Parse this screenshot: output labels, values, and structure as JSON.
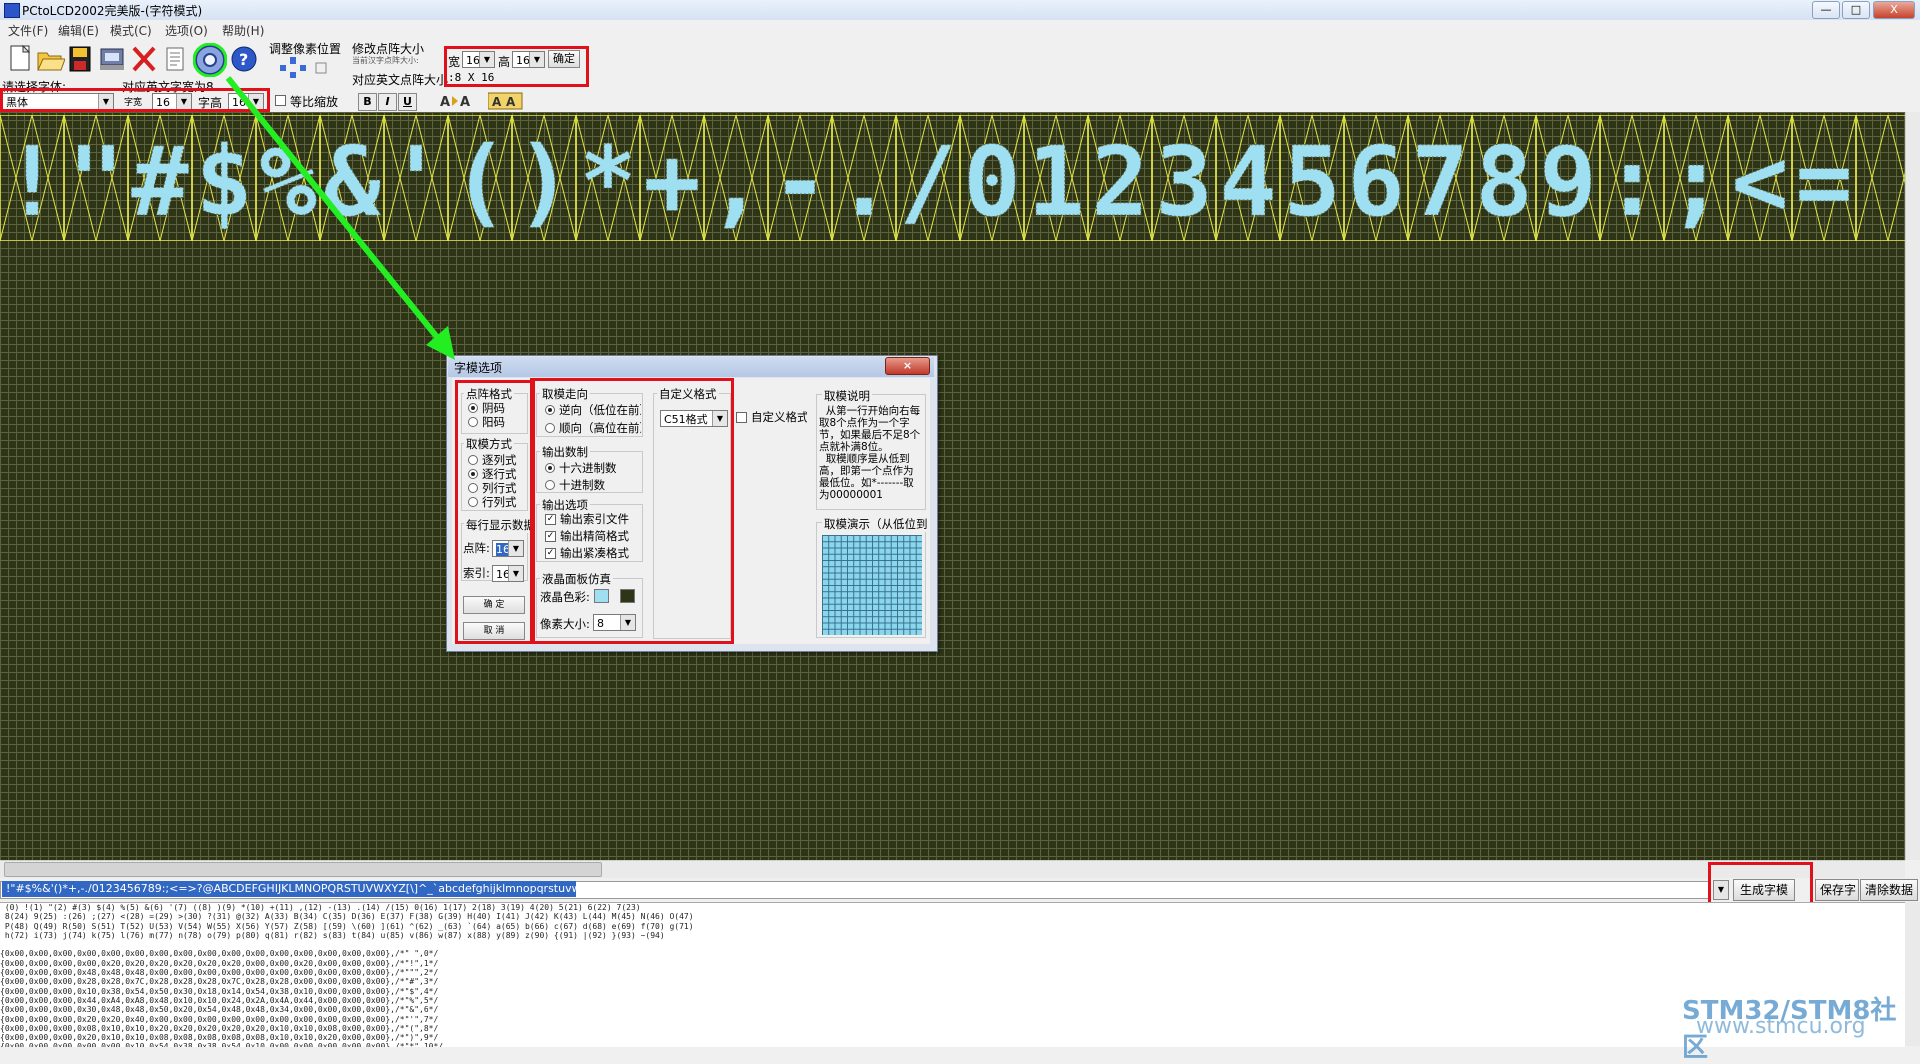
{
  "window": {
    "title": "PCtoLCD2002完美版-(字符模式)",
    "minimize": "—",
    "maximize": "□",
    "close": "X"
  },
  "menu": [
    "文件(F)",
    "编辑(E)",
    "模式(C)",
    "选项(O)",
    "帮助(H)"
  ],
  "toolbar": {
    "icons": [
      "new-icon",
      "open-icon",
      "save-icon",
      "export-icon",
      "delete-icon",
      "list-icon",
      "options-gear-icon",
      "help-icon"
    ],
    "adjust_pixel_label": "调整像素位置",
    "modify_size_label": "修改点阵大小",
    "modify_size_hint": "当前汉字点阵大小:",
    "width_label": "宽",
    "width_value": "16",
    "height_label": "高",
    "height_value": "16",
    "resize_label": "确定",
    "english_size_label": "对应英文点阵大小",
    "english_size_value": ":8 X 16",
    "font_label": "请选择字体:",
    "font_value": "黑体",
    "english_note_label": "对应英文字宽为8",
    "char_width_label": "字宽",
    "char_width_value": "16",
    "char_height_label": "字高",
    "char_height_value": "16",
    "proportional_label": "等比缩放",
    "bold": "B",
    "italic": "I",
    "underline": "U"
  },
  "preview_chars": [
    "!",
    "\"",
    "#",
    "$",
    "%",
    "&",
    "'",
    "(",
    ")",
    "*",
    "+",
    ",",
    "-",
    ".",
    "/",
    "0",
    "1",
    "2",
    "3",
    "4",
    "5",
    "6",
    "7",
    "8",
    "9",
    ":",
    ";",
    "<",
    "="
  ],
  "colors": {
    "lcd_bg": "#2e3516",
    "lcd_grid": "#5c6240",
    "lcd_pixel": "#9ee0f2",
    "char_box": "#e4e44a",
    "highlight": "#e0111b",
    "arrow": "#22ee22"
  },
  "char_input": " !\"#$%&'()*+,-./0123456789:;<=>?@ABCDEFGHIJKLMNOPQRSTUVWXYZ[\\]^_`abcdefghijklmnopqrstuvwxyz{|}~",
  "buttons": {
    "generate": "生成字模",
    "save": "保存字模",
    "clear": "清除数据"
  },
  "output_text": " (0) !(1) \"(2) #(3) $(4) %(5) &(6) '(7) ((8) )(9) *(10) +(11) ,(12) -(13) .(14) /(15) 0(16) 1(17) 2(18) 3(19) 4(20) 5(21) 6(22) 7(23)\n 8(24) 9(25) :(26) ;(27) <(28) =(29) >(30) ?(31) @(32) A(33) B(34) C(35) D(36) E(37) F(38) G(39) H(40) I(41) J(42) K(43) L(44) M(45) N(46) O(47)\n P(48) Q(49) R(50) S(51) T(52) U(53) V(54) W(55) X(56) Y(57) Z(58) [(59) \\(60) ](61) ^(62) _(63) `(64) a(65) b(66) c(67) d(68) e(69) f(70) g(71)\n h(72) i(73) j(74) k(75) l(76) m(77) n(78) o(79) p(80) q(81) r(82) s(83) t(84) u(85) v(86) w(87) x(88) y(89) z(90) {(91) |(92) }(93) ~(94)\n\n{0x00,0x00,0x00,0x00,0x00,0x00,0x00,0x00,0x00,0x00,0x00,0x00,0x00,0x00,0x00,0x00},/*\" \",0*/\n{0x00,0x00,0x00,0x00,0x20,0x20,0x20,0x20,0x20,0x20,0x00,0x00,0x20,0x00,0x00,0x00},/*\"!\",1*/\n{0x00,0x00,0x00,0x48,0x48,0x48,0x00,0x00,0x00,0x00,0x00,0x00,0x00,0x00,0x00,0x00},/*\"\"\",2*/\n{0x00,0x00,0x00,0x28,0x28,0x7C,0x28,0x28,0x28,0x7C,0x28,0x28,0x00,0x00,0x00,0x00},/*\"#\",3*/\n{0x00,0x00,0x00,0x10,0x38,0x54,0x50,0x30,0x18,0x14,0x54,0x38,0x10,0x00,0x00,0x00},/*\"$\",4*/\n{0x00,0x00,0x00,0x44,0xA4,0xA8,0x48,0x10,0x10,0x24,0x2A,0x4A,0x44,0x00,0x00,0x00},/*\"%\",5*/\n{0x00,0x00,0x00,0x30,0x48,0x48,0x50,0x20,0x54,0x48,0x48,0x34,0x00,0x00,0x00,0x00},/*\"&\",6*/\n{0x00,0x00,0x00,0x20,0x20,0x40,0x00,0x00,0x00,0x00,0x00,0x00,0x00,0x00,0x00,0x00},/*\"'\",7*/\n{0x00,0x00,0x00,0x08,0x10,0x10,0x20,0x20,0x20,0x20,0x20,0x10,0x10,0x08,0x00,0x00},/*\"(\",8*/\n{0x00,0x00,0x00,0x20,0x10,0x10,0x08,0x08,0x08,0x08,0x08,0x10,0x10,0x20,0x00,0x00},/*\")\",9*/\n{0x00,0x00,0x00,0x00,0x00,0x10,0x54,0x38,0x38,0x54,0x10,0x00,0x00,0x00,0x00,0x00},/*\"*\",10*/",
  "watermark": {
    "line1": "STM32/STM8社区",
    "line2": "www.stmcu.org"
  },
  "dialog": {
    "title": "字模选项",
    "close": "×",
    "dot_format": {
      "title": "点阵格式",
      "options": [
        "阴码",
        "阳码"
      ],
      "selected": 0
    },
    "scan_mode": {
      "title": "取模方式",
      "options": [
        "逐列式",
        "逐行式",
        "列行式",
        "行列式"
      ],
      "selected": 1
    },
    "per_line": {
      "title": "每行显示数据",
      "dots_label": "点阵:",
      "dots_value": "16",
      "index_label": "索引:",
      "index_value": "16"
    },
    "ok": "确  定",
    "cancel": "取  消",
    "direction": {
      "title": "取模走向",
      "options": [
        "逆向（低位在前）",
        "顺向（高位在前）"
      ],
      "selected": 0
    },
    "radix": {
      "title": "输出数制",
      "options": [
        "十六进制数",
        "十进制数"
      ],
      "selected": 0
    },
    "output_opts": {
      "title": "输出选项",
      "options": [
        "输出索引文件",
        "输出精简格式",
        "输出紧凑格式"
      ]
    },
    "lcd_sim": {
      "title": "液晶面板仿真",
      "color_label": "液晶色彩:",
      "pixel_size_label": "像素大小:",
      "pixel_size_value": "8"
    },
    "custom_format": {
      "title": "自定义格式",
      "format_value": "C51格式",
      "custom_check": "自定义格式"
    },
    "explanation": {
      "title": "取模说明",
      "text": "  从第一行开始向右每取8个点作为一个字节，如果最后不足8个点就补满8位。\n  取模顺序是从低到高，即第一个点作为最低位。如*-------取为00000001"
    },
    "demo": {
      "title": "取模演示（从低位到高位）"
    }
  }
}
